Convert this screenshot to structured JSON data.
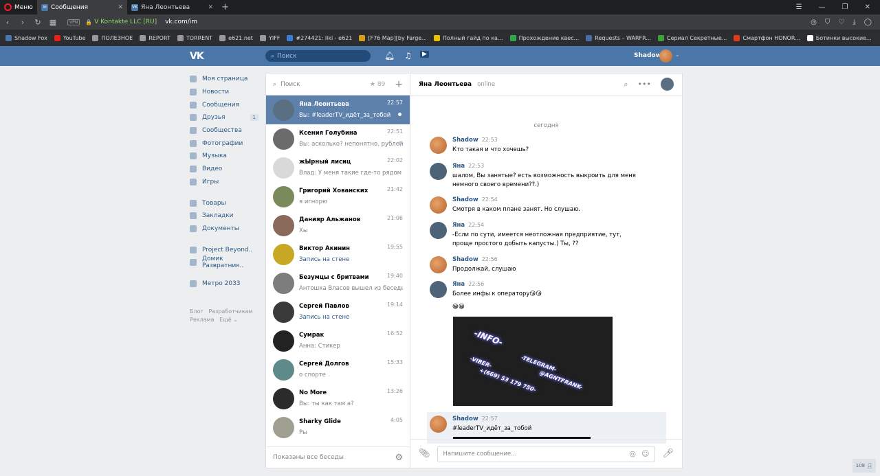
{
  "browser": {
    "menu_label": "Меню",
    "tabs": [
      {
        "label": "Сообщения",
        "active": true
      },
      {
        "label": "Яна Леонтьева",
        "active": false
      }
    ],
    "vpn": "VPN",
    "secure_label": "V Kontakte LLC [RU]",
    "url": "vk.com/im",
    "bookmarks": [
      {
        "label": "Shadow Fox",
        "color": "#4a76a8"
      },
      {
        "label": "YouTube",
        "color": "#e62117"
      },
      {
        "label": "ПОЛЕЗНОЕ",
        "color": "#999999"
      },
      {
        "label": "REPORT",
        "color": "#999999"
      },
      {
        "label": "TORRENT",
        "color": "#999999"
      },
      {
        "label": "e621.net",
        "color": "#999999"
      },
      {
        "label": "YIFF",
        "color": "#999999"
      },
      {
        "label": "#274421: liki - e621",
        "color": "#3b7dd8"
      },
      {
        "label": "[F76 Map][by Farge...",
        "color": "#d4a017"
      },
      {
        "label": "Полный гайд по ка...",
        "color": "#e8c000"
      },
      {
        "label": "Прохождение квес...",
        "color": "#2fa84f"
      },
      {
        "label": "Requests – WARFR...",
        "color": "#4a6fa5"
      },
      {
        "label": "Сериал Секретные...",
        "color": "#3ca03c"
      },
      {
        "label": "Смартфон HONOR...",
        "color": "#e03a1e"
      },
      {
        "label": "Ботинки высокие...",
        "color": "#ffffff"
      }
    ]
  },
  "header": {
    "logo": "VK",
    "search_placeholder": "Поиск",
    "user_name": "Shadow"
  },
  "menu": {
    "items": [
      {
        "label": "Моя страница",
        "icon": "home-icon"
      },
      {
        "label": "Новости",
        "icon": "news-icon"
      },
      {
        "label": "Сообщения",
        "icon": "messages-icon"
      },
      {
        "label": "Друзья",
        "icon": "friends-icon",
        "badge": "1"
      },
      {
        "label": "Сообщества",
        "icon": "groups-icon"
      },
      {
        "label": "Фотографии",
        "icon": "photo-icon"
      },
      {
        "label": "Музыка",
        "icon": "music-icon"
      },
      {
        "label": "Видео",
        "icon": "video-icon"
      },
      {
        "label": "Игры",
        "icon": "games-icon"
      }
    ],
    "items2": [
      {
        "label": "Товары",
        "icon": "goods-icon"
      },
      {
        "label": "Закладки",
        "icon": "bookmark-icon"
      },
      {
        "label": "Документы",
        "icon": "docs-icon"
      }
    ],
    "items3": [
      {
        "label": "Project Beyond..",
        "icon": "group-icon"
      },
      {
        "label": "Домик Развратник..",
        "icon": "group-icon"
      }
    ],
    "items4": [
      {
        "label": "Метро 2033",
        "icon": "game-icon"
      }
    ],
    "footer": {
      "blog": "Блог",
      "dev": "Разработчикам",
      "ads": "Реклама",
      "more": "Ещё"
    }
  },
  "dialogs": {
    "search_placeholder": "Поиск",
    "fav_count": "89",
    "footer": "Показаны все беседы",
    "items": [
      {
        "name": "Яна Леонтьева",
        "time": "22:57",
        "preview": "Вы: #leaderTV_идёт_за_тобой",
        "active": true,
        "dot": true
      },
      {
        "name": "Ксения Голубина",
        "time": "22:51",
        "preview": "Вы: асколько? непонятно. рублей ...",
        "dot": true
      },
      {
        "name": "жЫрный лисиц",
        "time": "22:02",
        "preview": "Влад: У меня такие где-то рядом с каж..."
      },
      {
        "name": "Григорий Хованских",
        "time": "21:42",
        "preview": "я игнорю"
      },
      {
        "name": "Данияр Альжанов",
        "time": "21:06",
        "preview": "Хы"
      },
      {
        "name": "Виктор Акинин",
        "time": "19:55",
        "preview": "Запись на стене",
        "blue": true
      },
      {
        "name": "Безумцы с бритвами",
        "time": "19:40",
        "preview": "Антошка Власов вышел из беседы"
      },
      {
        "name": "Сергей Павлов",
        "time": "19:14",
        "preview": "Запись на стене",
        "blue": true
      },
      {
        "name": "Сумрак",
        "time": "16:52",
        "preview": "Анна: Стикер"
      },
      {
        "name": "Сергей Долгов",
        "time": "15:33",
        "preview": "о спорте"
      },
      {
        "name": "No More",
        "time": "13:26",
        "preview": "Вы: ты как там а?"
      },
      {
        "name": "Sharky Glide",
        "time": "4:05",
        "preview": "Ры"
      }
    ]
  },
  "chat": {
    "name": "Яна Леонтьева",
    "status": "online",
    "day": "сегодня",
    "messages": [
      {
        "author": "Shadow",
        "time": "22:53",
        "text": "Кто такая и что хочешь?"
      },
      {
        "author": "Яна",
        "time": "22:53",
        "text": "шалом, Вы занятые? есть возможность выкроить для меня немного своего времени??.)"
      },
      {
        "author": "Shadow",
        "time": "22:54",
        "text": "Смотря в каком плане занят. Но слушаю."
      },
      {
        "author": "Яна",
        "time": "22:54",
        "text": "-Если по сути, имеется неотложная предприятие, тут, проще простого добыть капусты.) Ты, ??"
      },
      {
        "author": "Shadow",
        "time": "22:56",
        "text": "Продолжай, слушаю"
      },
      {
        "author": "Яна",
        "time": "22:56",
        "text": "Более инфы к оператору😘😘",
        "emoji": "😁😁"
      },
      {
        "author": "Shadow",
        "time": "22:57",
        "text": "#leaderTV_идёт_за_тобой"
      }
    ],
    "image_text": {
      "info": "-INFO-",
      "viber": "-VIBER-",
      "phone": "+(669) 53 179 750-",
      "telegram": "-TELEGRAM-",
      "handle": "@AGNTFRANK-"
    },
    "input_placeholder": "Напишите сообщение..."
  },
  "corner_count": "108"
}
